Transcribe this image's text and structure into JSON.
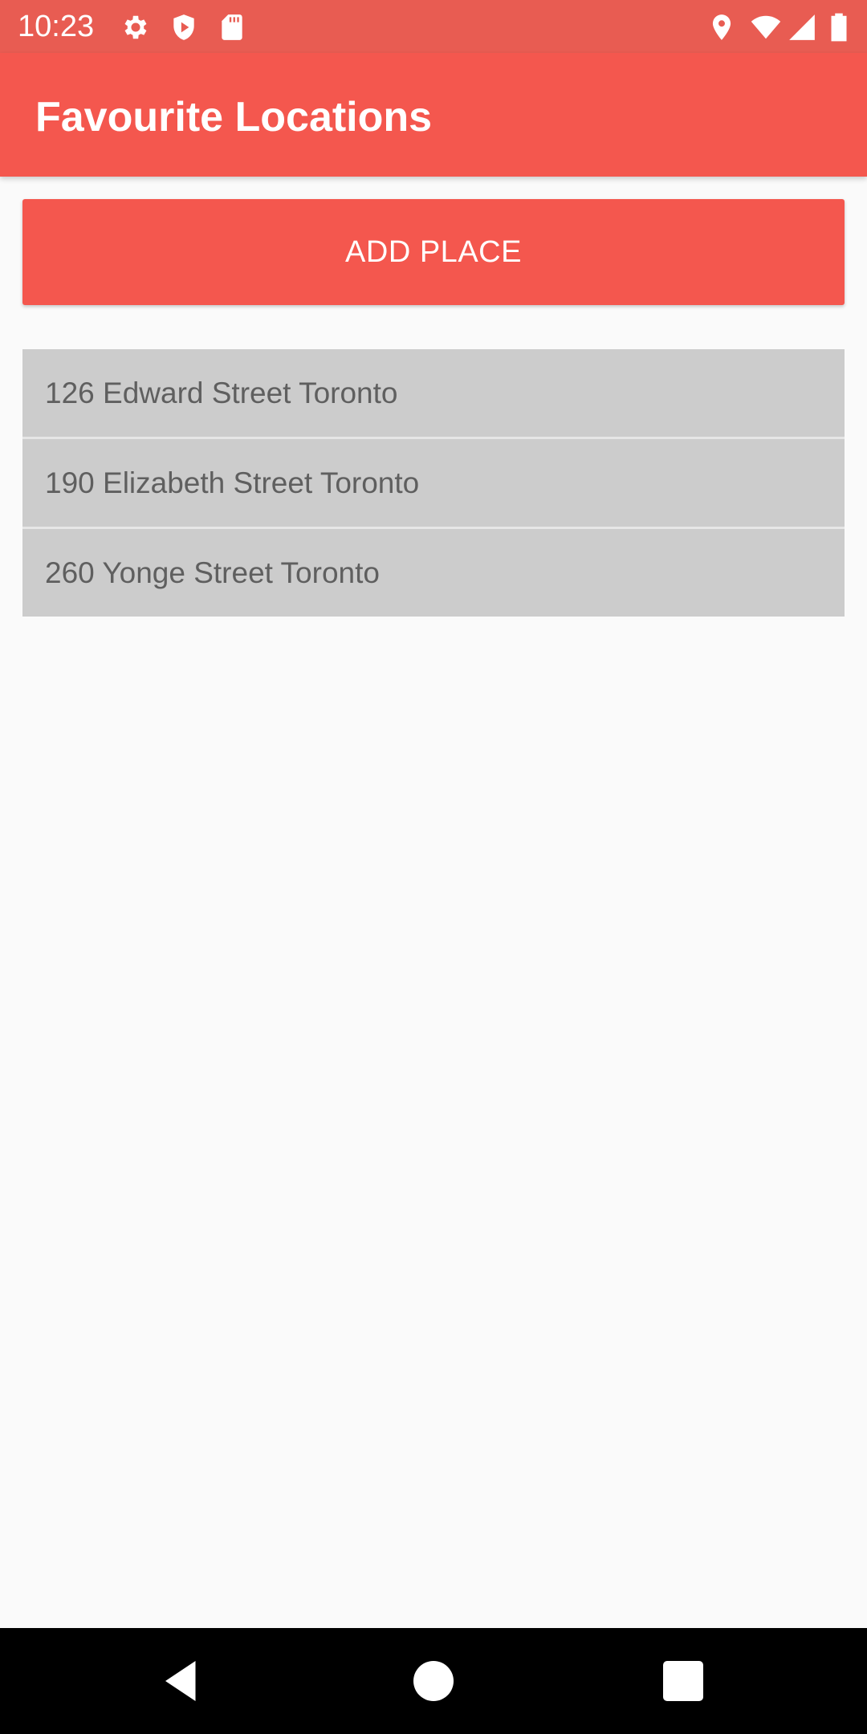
{
  "status_bar": {
    "time": "10:23",
    "left_icons": [
      "gear-icon",
      "shield-play-icon",
      "sd-card-icon"
    ],
    "right_icons": [
      "location-pin-icon",
      "wifi-icon",
      "cell-signal-icon",
      "battery-icon"
    ]
  },
  "app_bar": {
    "title": "Favourite Locations"
  },
  "actions": {
    "add_place_label": "ADD PLACE"
  },
  "locations": [
    "126 Edward Street Toronto",
    "190 Elizabeth Street Toronto",
    "260 Yonge Street Toronto"
  ],
  "nav_bar": {
    "buttons": [
      "back-icon",
      "home-icon",
      "recents-icon"
    ]
  },
  "colors": {
    "primary": "#f4574e",
    "primary_dark": "#e85c52",
    "list_item_bg": "#cccccc",
    "list_text": "#5f5f5f",
    "background": "#fafafa"
  }
}
